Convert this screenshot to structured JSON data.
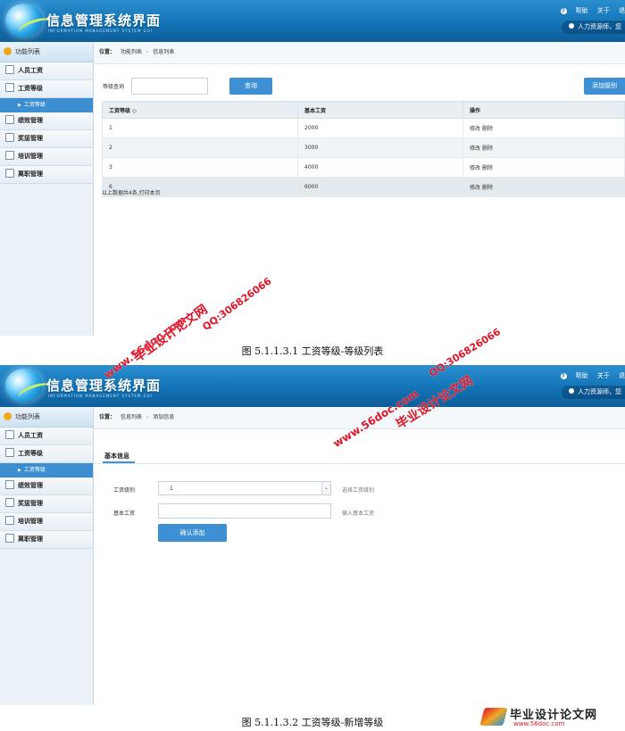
{
  "app": {
    "title": "信息管理系统界面",
    "subtitle": "INFORMATION MANAGEMENT SYSTEM GUI",
    "help": "帮助",
    "about": "关于",
    "exit": "退",
    "user": "人力资源师，您"
  },
  "sidebar": {
    "header": "功能列表",
    "items": [
      {
        "label": "人员工资"
      },
      {
        "label": "工资等级"
      },
      {
        "label": "工资等级"
      },
      {
        "label": "绩效管理"
      },
      {
        "label": "奖惩管理"
      },
      {
        "label": "培训管理"
      },
      {
        "label": "离职管理"
      }
    ]
  },
  "list_view": {
    "breadcrumb": {
      "prefix": "位置：",
      "parent": "功能列表",
      "current": "信息列表"
    },
    "search_label": "等级查询",
    "search_value": "",
    "search_button": "查询",
    "add_button": "添加级别",
    "columns": [
      "工资等级",
      "基本工资",
      "操作"
    ],
    "sort_indicator": "◇",
    "rows": [
      {
        "level": "1",
        "salary": "2000",
        "edit": "修改",
        "delete": "删除"
      },
      {
        "level": "2",
        "salary": "3000",
        "edit": "修改",
        "delete": "删除"
      },
      {
        "level": "3",
        "salary": "4000",
        "edit": "修改",
        "delete": "删除"
      },
      {
        "level": "6",
        "salary": "6000",
        "edit": "修改",
        "delete": "删除"
      }
    ],
    "total_text": "以上数据共4条,打印本页"
  },
  "caption1": "图  5.1.1.3.1  工资等级-等级列表",
  "add_view": {
    "breadcrumb": {
      "prefix": "位置：",
      "parent": "信息列表",
      "current": "添加信息"
    },
    "section_title": "基本信息",
    "fields": {
      "level_label": "工资级别",
      "level_value": "1",
      "level_hint": "选择工资级别",
      "salary_label": "基本工资",
      "salary_value": "",
      "salary_hint": "输入基本工资"
    },
    "submit_button": "确认添加"
  },
  "caption2": "图  5.1.1.3.2 工资等级-新增等级",
  "watermarks": {
    "site": "www.56doc.com",
    "name": "毕业设计论文网",
    "qq": "QQ:306826066"
  },
  "footer_logo": {
    "name": "毕业设计论文网",
    "url": "www.56doc.com"
  },
  "colors": {
    "accent": "#3d90d3",
    "header": "#1473b6",
    "watermark": "#e0162a"
  }
}
